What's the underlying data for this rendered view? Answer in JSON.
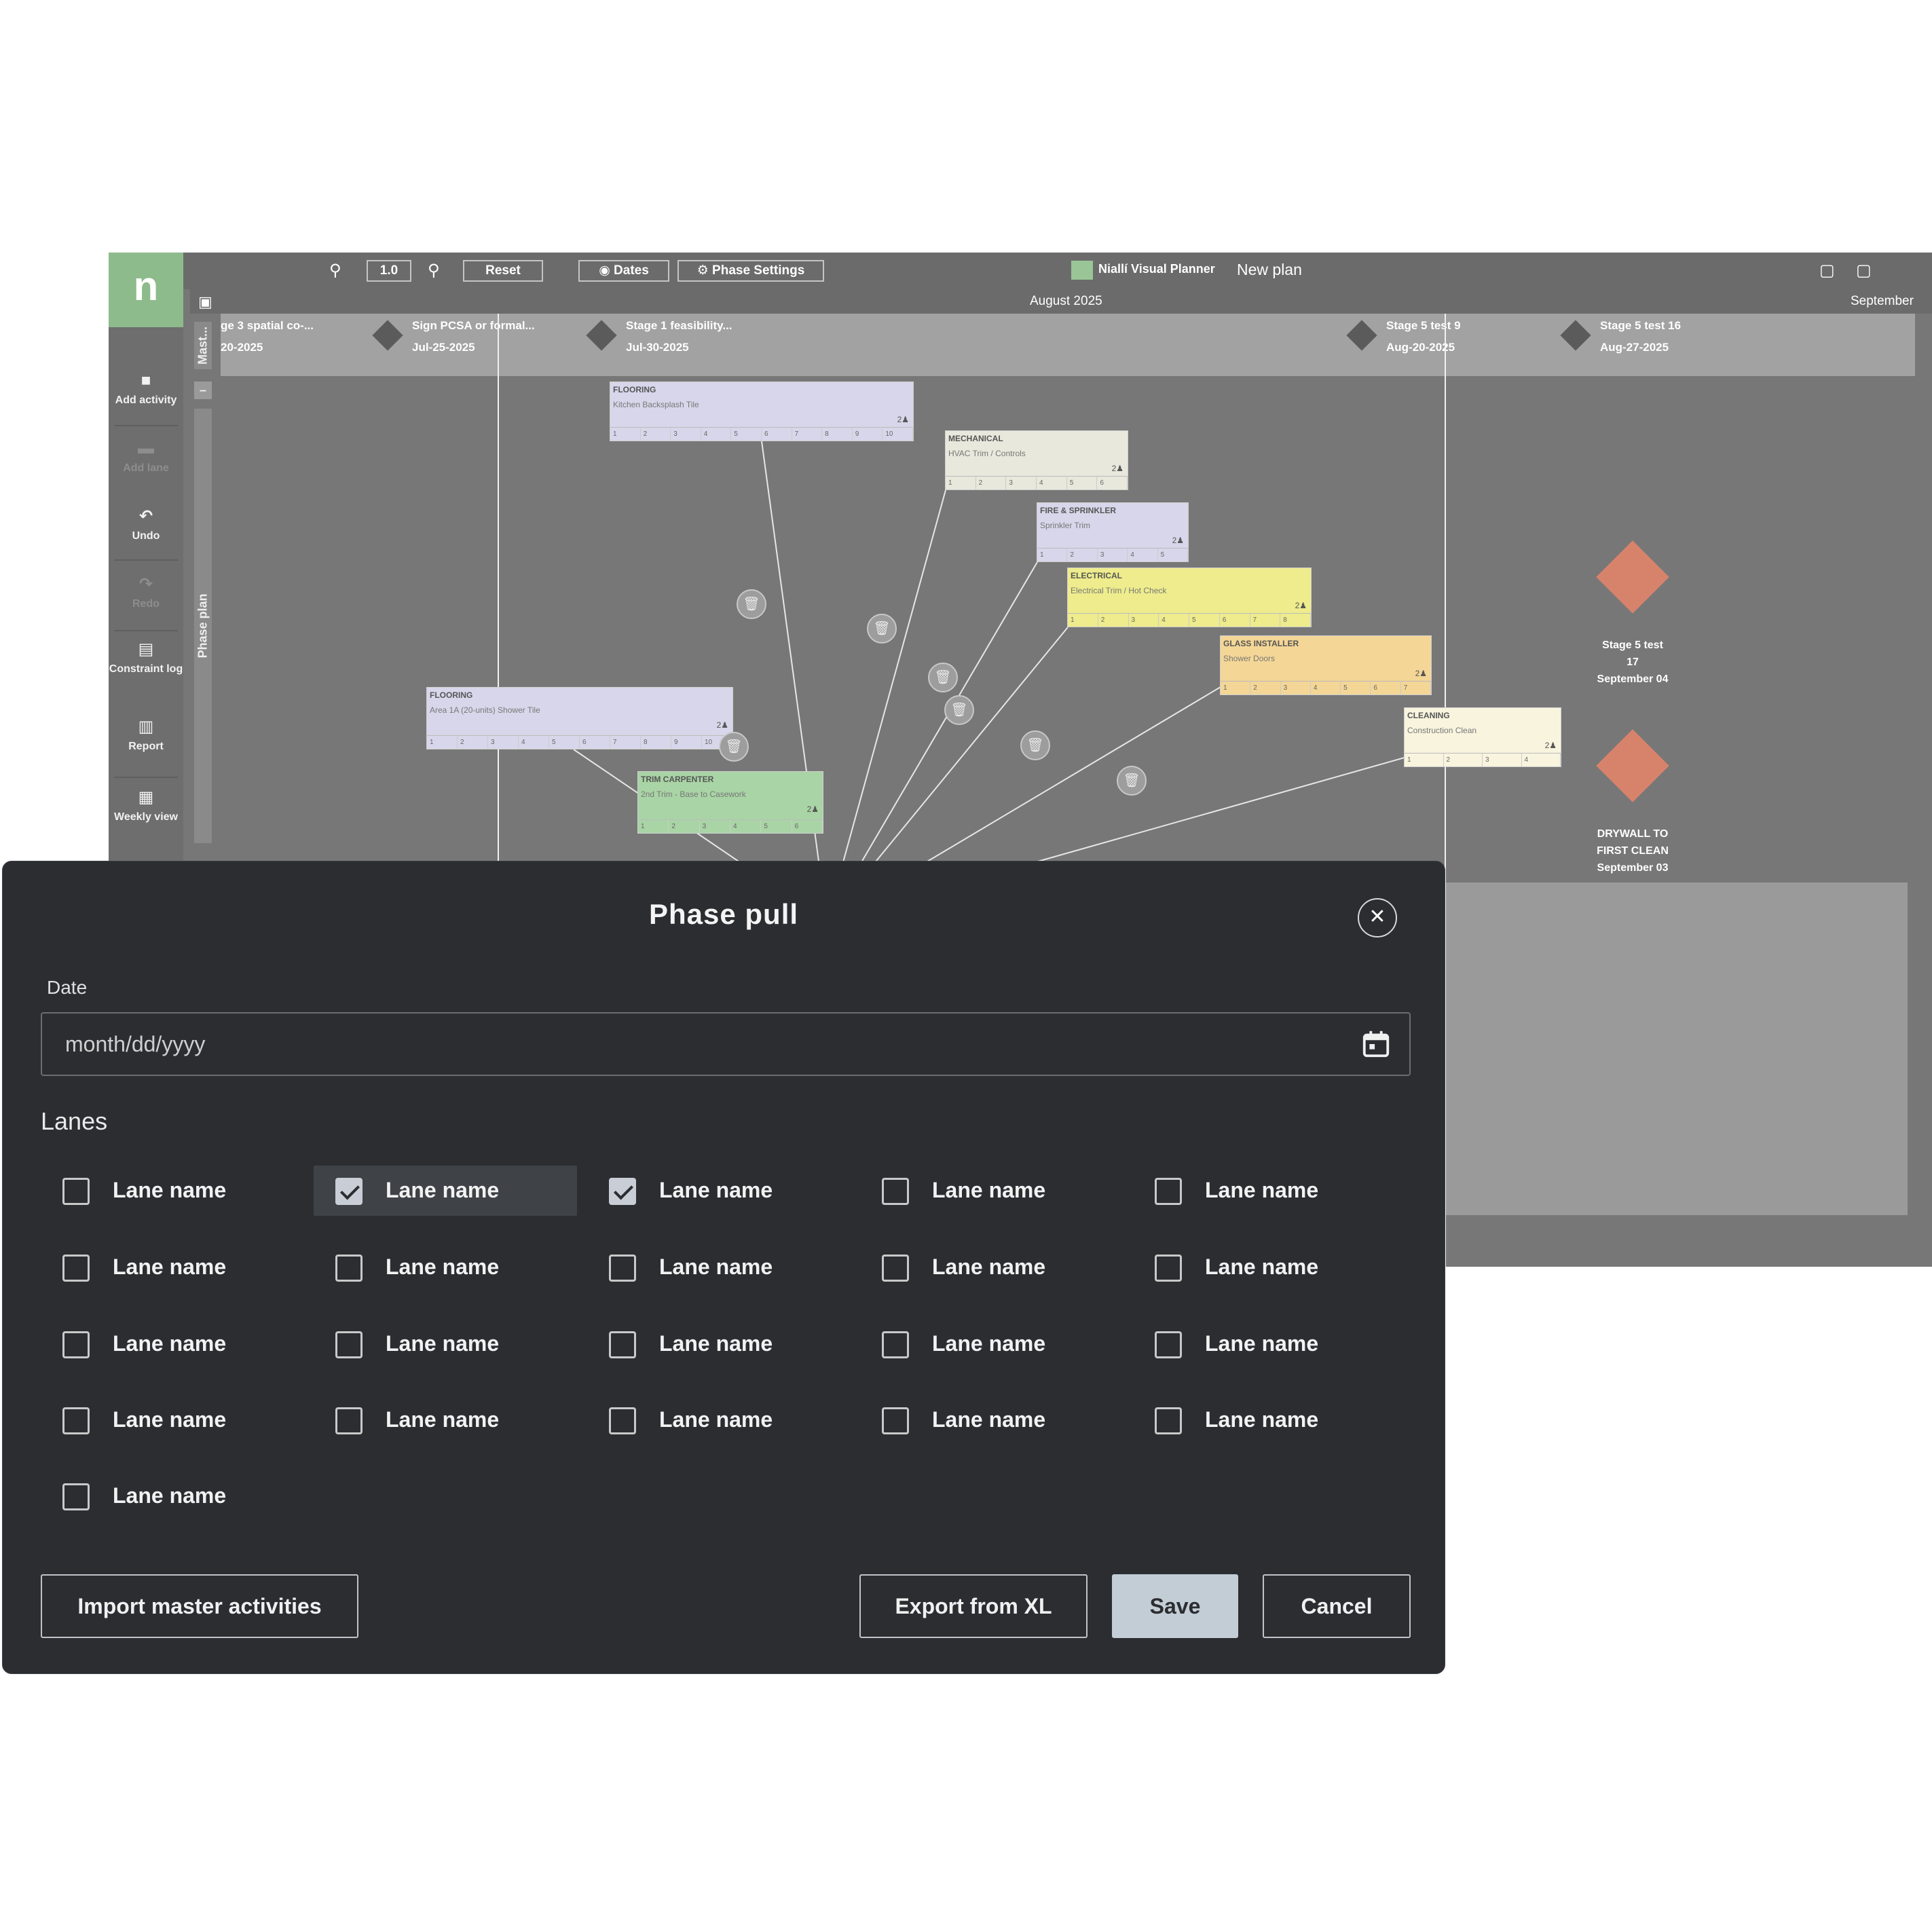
{
  "app": {
    "logo_letter": "n",
    "brand": "Niallí Visual Planner",
    "plan_name": "New plan",
    "zoom_value": "1.0",
    "reset_label": "Reset",
    "dates_label": "Dates",
    "phase_settings_label": "Phase Settings",
    "month_current": "August 2025",
    "month_next": "September",
    "rail": [
      {
        "label": "Add activity",
        "icon": "square-icon",
        "disabled": false
      },
      {
        "label": "Add lane",
        "icon": "lane-icon",
        "disabled": true
      },
      {
        "label": "Undo",
        "icon": "undo-icon",
        "disabled": false
      },
      {
        "label": "Redo",
        "icon": "redo-icon",
        "disabled": true
      },
      {
        "label": "Constraint log",
        "icon": "list-icon",
        "disabled": false
      },
      {
        "label": "Report",
        "icon": "report-icon",
        "disabled": false
      },
      {
        "label": "Weekly view",
        "icon": "grid-icon",
        "disabled": false
      }
    ],
    "side_tabs": [
      "Mast...",
      "Phase plan"
    ],
    "milestones": [
      {
        "label": "ge 3 spatial co-...",
        "date": "20-2025"
      },
      {
        "label": "Sign PCSA or formal...",
        "date": "Jul-25-2025"
      },
      {
        "label": "Stage 1 feasibility...",
        "date": "Jul-30-2025"
      },
      {
        "label": "Stage 5 test 9",
        "date": "Aug-20-2025"
      },
      {
        "label": "Stage 5 test 16",
        "date": "Aug-27-2025"
      }
    ],
    "cards": [
      {
        "trade": "FLOORING",
        "name": "Kitchen Backsplash Tile",
        "crew": "2♟",
        "days": [
          "1",
          "2",
          "3",
          "4",
          "5",
          "6",
          "7",
          "8",
          "9",
          "10"
        ],
        "color": "#d8d6ea"
      },
      {
        "trade": "MECHANICAL",
        "name": "HVAC Trim / Controls",
        "crew": "2♟",
        "days": [
          "1",
          "2",
          "3",
          "4",
          "5",
          "6"
        ],
        "color": "#e8e8dc"
      },
      {
        "trade": "FIRE & SPRINKLER",
        "name": "Sprinkler Trim",
        "crew": "2♟",
        "days": [
          "1",
          "2",
          "3",
          "4",
          "5"
        ],
        "color": "#d8d6ea"
      },
      {
        "trade": "ELECTRICAL",
        "name": "Electrical Trim / Hot Check",
        "crew": "2♟",
        "days": [
          "1",
          "2",
          "3",
          "4",
          "5",
          "6",
          "7",
          "8"
        ],
        "color": "#eeec8c"
      },
      {
        "trade": "GLASS INSTALLER",
        "name": "Shower Doors",
        "crew": "2♟",
        "days": [
          "1",
          "2",
          "3",
          "4",
          "5",
          "6",
          "7"
        ],
        "color": "#f4d696"
      },
      {
        "trade": "CLEANING",
        "name": "Construction Clean",
        "crew": "2♟",
        "days": [
          "1",
          "2",
          "3",
          "4"
        ],
        "color": "#f8f4de"
      },
      {
        "trade": "FLOORING",
        "name": "Area 1A (20-units) Shower Tile",
        "crew": "2♟",
        "days": [
          "1",
          "2",
          "3",
          "4",
          "5",
          "6",
          "7",
          "8",
          "9",
          "10"
        ],
        "color": "#d8d6ea"
      },
      {
        "trade": "TRIM CARPENTER",
        "name": "2nd Trim - Base to Casework",
        "crew": "2♟",
        "days": [
          "1",
          "2",
          "3",
          "4",
          "5",
          "6"
        ],
        "color": "#a9d4a5"
      }
    ],
    "big_milestones": [
      {
        "label": "Stage 5 test 17",
        "date": "September 04",
        "lines": [
          "Stage 5 test",
          "17",
          "September 04"
        ]
      },
      {
        "label": "DRYWALL TO FIRST CLEAN",
        "date": "September 03",
        "lines": [
          "DRYWALL TO",
          "FIRST CLEAN",
          "September 03"
        ]
      }
    ],
    "colors": {
      "milestone_diamond": "#d7836b",
      "logo_green": "#8dbb8b"
    }
  },
  "modal": {
    "title": "Phase pull",
    "close_icon": "close-icon",
    "date_label": "Date",
    "date_value": "",
    "date_placeholder": "month/dd/yyyy",
    "lanes_heading": "Lanes",
    "lanes": [
      {
        "label": "Lane name",
        "checked": false
      },
      {
        "label": "Lane name",
        "checked": true
      },
      {
        "label": "Lane name",
        "checked": true
      },
      {
        "label": "Lane name",
        "checked": false
      },
      {
        "label": "Lane name",
        "checked": false
      },
      {
        "label": "Lane name",
        "checked": false
      },
      {
        "label": "Lane name",
        "checked": false
      },
      {
        "label": "Lane name",
        "checked": false
      },
      {
        "label": "Lane name",
        "checked": false
      },
      {
        "label": "Lane name",
        "checked": false
      },
      {
        "label": "Lane name",
        "checked": false
      },
      {
        "label": "Lane name",
        "checked": false
      },
      {
        "label": "Lane name",
        "checked": false
      },
      {
        "label": "Lane name",
        "checked": false
      },
      {
        "label": "Lane name",
        "checked": false
      },
      {
        "label": "Lane name",
        "checked": false
      },
      {
        "label": "Lane name",
        "checked": false
      },
      {
        "label": "Lane name",
        "checked": false
      },
      {
        "label": "Lane name",
        "checked": false
      },
      {
        "label": "Lane name",
        "checked": false
      },
      {
        "label": "Lane name",
        "checked": false
      }
    ],
    "buttons": {
      "import": "Import master activities",
      "export": "Export from XL",
      "save": "Save",
      "cancel": "Cancel"
    }
  }
}
